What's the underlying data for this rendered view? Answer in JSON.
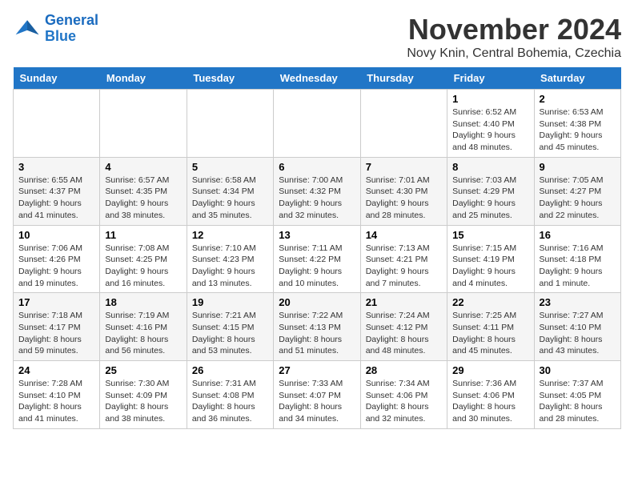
{
  "logo": {
    "line1": "General",
    "line2": "Blue"
  },
  "title": "November 2024",
  "subtitle": "Novy Knin, Central Bohemia, Czechia",
  "days_of_week": [
    "Sunday",
    "Monday",
    "Tuesday",
    "Wednesday",
    "Thursday",
    "Friday",
    "Saturday"
  ],
  "weeks": [
    [
      {
        "day": "",
        "info": ""
      },
      {
        "day": "",
        "info": ""
      },
      {
        "day": "",
        "info": ""
      },
      {
        "day": "",
        "info": ""
      },
      {
        "day": "",
        "info": ""
      },
      {
        "day": "1",
        "info": "Sunrise: 6:52 AM\nSunset: 4:40 PM\nDaylight: 9 hours and 48 minutes."
      },
      {
        "day": "2",
        "info": "Sunrise: 6:53 AM\nSunset: 4:38 PM\nDaylight: 9 hours and 45 minutes."
      }
    ],
    [
      {
        "day": "3",
        "info": "Sunrise: 6:55 AM\nSunset: 4:37 PM\nDaylight: 9 hours and 41 minutes."
      },
      {
        "day": "4",
        "info": "Sunrise: 6:57 AM\nSunset: 4:35 PM\nDaylight: 9 hours and 38 minutes."
      },
      {
        "day": "5",
        "info": "Sunrise: 6:58 AM\nSunset: 4:34 PM\nDaylight: 9 hours and 35 minutes."
      },
      {
        "day": "6",
        "info": "Sunrise: 7:00 AM\nSunset: 4:32 PM\nDaylight: 9 hours and 32 minutes."
      },
      {
        "day": "7",
        "info": "Sunrise: 7:01 AM\nSunset: 4:30 PM\nDaylight: 9 hours and 28 minutes."
      },
      {
        "day": "8",
        "info": "Sunrise: 7:03 AM\nSunset: 4:29 PM\nDaylight: 9 hours and 25 minutes."
      },
      {
        "day": "9",
        "info": "Sunrise: 7:05 AM\nSunset: 4:27 PM\nDaylight: 9 hours and 22 minutes."
      }
    ],
    [
      {
        "day": "10",
        "info": "Sunrise: 7:06 AM\nSunset: 4:26 PM\nDaylight: 9 hours and 19 minutes."
      },
      {
        "day": "11",
        "info": "Sunrise: 7:08 AM\nSunset: 4:25 PM\nDaylight: 9 hours and 16 minutes."
      },
      {
        "day": "12",
        "info": "Sunrise: 7:10 AM\nSunset: 4:23 PM\nDaylight: 9 hours and 13 minutes."
      },
      {
        "day": "13",
        "info": "Sunrise: 7:11 AM\nSunset: 4:22 PM\nDaylight: 9 hours and 10 minutes."
      },
      {
        "day": "14",
        "info": "Sunrise: 7:13 AM\nSunset: 4:21 PM\nDaylight: 9 hours and 7 minutes."
      },
      {
        "day": "15",
        "info": "Sunrise: 7:15 AM\nSunset: 4:19 PM\nDaylight: 9 hours and 4 minutes."
      },
      {
        "day": "16",
        "info": "Sunrise: 7:16 AM\nSunset: 4:18 PM\nDaylight: 9 hours and 1 minute."
      }
    ],
    [
      {
        "day": "17",
        "info": "Sunrise: 7:18 AM\nSunset: 4:17 PM\nDaylight: 8 hours and 59 minutes."
      },
      {
        "day": "18",
        "info": "Sunrise: 7:19 AM\nSunset: 4:16 PM\nDaylight: 8 hours and 56 minutes."
      },
      {
        "day": "19",
        "info": "Sunrise: 7:21 AM\nSunset: 4:15 PM\nDaylight: 8 hours and 53 minutes."
      },
      {
        "day": "20",
        "info": "Sunrise: 7:22 AM\nSunset: 4:13 PM\nDaylight: 8 hours and 51 minutes."
      },
      {
        "day": "21",
        "info": "Sunrise: 7:24 AM\nSunset: 4:12 PM\nDaylight: 8 hours and 48 minutes."
      },
      {
        "day": "22",
        "info": "Sunrise: 7:25 AM\nSunset: 4:11 PM\nDaylight: 8 hours and 45 minutes."
      },
      {
        "day": "23",
        "info": "Sunrise: 7:27 AM\nSunset: 4:10 PM\nDaylight: 8 hours and 43 minutes."
      }
    ],
    [
      {
        "day": "24",
        "info": "Sunrise: 7:28 AM\nSunset: 4:10 PM\nDaylight: 8 hours and 41 minutes."
      },
      {
        "day": "25",
        "info": "Sunrise: 7:30 AM\nSunset: 4:09 PM\nDaylight: 8 hours and 38 minutes."
      },
      {
        "day": "26",
        "info": "Sunrise: 7:31 AM\nSunset: 4:08 PM\nDaylight: 8 hours and 36 minutes."
      },
      {
        "day": "27",
        "info": "Sunrise: 7:33 AM\nSunset: 4:07 PM\nDaylight: 8 hours and 34 minutes."
      },
      {
        "day": "28",
        "info": "Sunrise: 7:34 AM\nSunset: 4:06 PM\nDaylight: 8 hours and 32 minutes."
      },
      {
        "day": "29",
        "info": "Sunrise: 7:36 AM\nSunset: 4:06 PM\nDaylight: 8 hours and 30 minutes."
      },
      {
        "day": "30",
        "info": "Sunrise: 7:37 AM\nSunset: 4:05 PM\nDaylight: 8 hours and 28 minutes."
      }
    ]
  ]
}
